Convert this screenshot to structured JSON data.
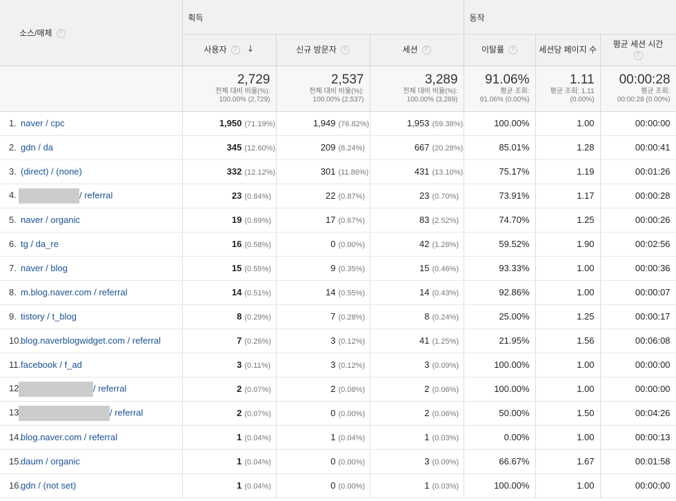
{
  "headers": {
    "source": "소스/매체",
    "group_acq": "획득",
    "group_beh": "동작",
    "users": "사용자",
    "new_users": "신규 방문자",
    "sessions": "세션",
    "bounce": "이탈률",
    "pages_per_session": "세션당 페이지 수",
    "avg_duration": "평균 세션 시간",
    "help_icon": "?",
    "sort_icon": "↓"
  },
  "totals": {
    "users": {
      "value": "2,729",
      "sub1": "전체 대비 비율(%):",
      "sub2": "100.00% (2,729)"
    },
    "new_users": {
      "value": "2,537",
      "sub1": "전체 대비 비율(%):",
      "sub2": "100.00% (2,537)"
    },
    "sessions": {
      "value": "3,289",
      "sub1": "전체 대비 비율(%):",
      "sub2": "100.00% (3,289)"
    },
    "bounce": {
      "value": "91.06%",
      "sub1": "평균 조회:",
      "sub2": "91.06% (0.00%)"
    },
    "pages": {
      "value": "1.11",
      "sub1": "평균 조회: 1.11",
      "sub2": "(0.00%)"
    },
    "duration": {
      "value": "00:00:28",
      "sub1": "평균 조회:",
      "sub2": "00:00:28 (0.00%)"
    }
  },
  "rows": [
    {
      "idx": "1.",
      "source": "naver / cpc",
      "users": "1,950",
      "users_pct": "(71.19%)",
      "new_users": "1,949",
      "new_users_pct": "(76.82%)",
      "sessions": "1,953",
      "sessions_pct": "(59.38%)",
      "bounce": "100.00%",
      "pages": "1.00",
      "duration": "00:00:00"
    },
    {
      "idx": "2.",
      "source": "gdn / da",
      "users": "345",
      "users_pct": "(12.60%)",
      "new_users": "209",
      "new_users_pct": "(8.24%)",
      "sessions": "667",
      "sessions_pct": "(20.28%)",
      "bounce": "85.01%",
      "pages": "1.28",
      "duration": "00:00:41"
    },
    {
      "idx": "3.",
      "source": "(direct) / (none)",
      "users": "332",
      "users_pct": "(12.12%)",
      "new_users": "301",
      "new_users_pct": "(11.86%)",
      "sessions": "431",
      "sessions_pct": "(13.10%)",
      "bounce": "75.17%",
      "pages": "1.19",
      "duration": "00:01:26"
    },
    {
      "idx": "4.",
      "source": "/ referral",
      "redacted": true,
      "users": "23",
      "users_pct": "(0.84%)",
      "new_users": "22",
      "new_users_pct": "(0.87%)",
      "sessions": "23",
      "sessions_pct": "(0.70%)",
      "bounce": "73.91%",
      "pages": "1.17",
      "duration": "00:00:28"
    },
    {
      "idx": "5.",
      "source": "naver / organic",
      "users": "19",
      "users_pct": "(0.69%)",
      "new_users": "17",
      "new_users_pct": "(0.67%)",
      "sessions": "83",
      "sessions_pct": "(2.52%)",
      "bounce": "74.70%",
      "pages": "1.25",
      "duration": "00:00:26"
    },
    {
      "idx": "6.",
      "source": "tg / da_re",
      "users": "16",
      "users_pct": "(0.58%)",
      "new_users": "0",
      "new_users_pct": "(0.00%)",
      "sessions": "42",
      "sessions_pct": "(1.28%)",
      "bounce": "59.52%",
      "pages": "1.90",
      "duration": "00:02:56"
    },
    {
      "idx": "7.",
      "source": "naver / blog",
      "users": "15",
      "users_pct": "(0.55%)",
      "new_users": "9",
      "new_users_pct": "(0.35%)",
      "sessions": "15",
      "sessions_pct": "(0.46%)",
      "bounce": "93.33%",
      "pages": "1.00",
      "duration": "00:00:36"
    },
    {
      "idx": "8.",
      "source": "m.blog.naver.com / referral",
      "users": "14",
      "users_pct": "(0.51%)",
      "new_users": "14",
      "new_users_pct": "(0.55%)",
      "sessions": "14",
      "sessions_pct": "(0.43%)",
      "bounce": "92.86%",
      "pages": "1.00",
      "duration": "00:00:07"
    },
    {
      "idx": "9.",
      "source": "tistory / t_blog",
      "users": "8",
      "users_pct": "(0.29%)",
      "new_users": "7",
      "new_users_pct": "(0.28%)",
      "sessions": "8",
      "sessions_pct": "(0.24%)",
      "bounce": "25.00%",
      "pages": "1.25",
      "duration": "00:00:17"
    },
    {
      "idx": "10.",
      "source": "blog.naverblogwidget.com / referral",
      "users": "7",
      "users_pct": "(0.26%)",
      "new_users": "3",
      "new_users_pct": "(0.12%)",
      "sessions": "41",
      "sessions_pct": "(1.25%)",
      "bounce": "21.95%",
      "pages": "1.56",
      "duration": "00:06:08"
    },
    {
      "idx": "11.",
      "source": "facebook / f_ad",
      "users": "3",
      "users_pct": "(0.11%)",
      "new_users": "3",
      "new_users_pct": "(0.12%)",
      "sessions": "3",
      "sessions_pct": "(0.09%)",
      "bounce": "100.00%",
      "pages": "1.00",
      "duration": "00:00:00"
    },
    {
      "idx": "12.",
      "source": "/ referral",
      "redacted": true,
      "users": "2",
      "users_pct": "(0.07%)",
      "new_users": "2",
      "new_users_pct": "(0.08%)",
      "sessions": "2",
      "sessions_pct": "(0.06%)",
      "bounce": "100.00%",
      "pages": "1.00",
      "duration": "00:00:00"
    },
    {
      "idx": "13.",
      "source": "/ referral",
      "redacted": true,
      "users": "2",
      "users_pct": "(0.07%)",
      "new_users": "0",
      "new_users_pct": "(0.00%)",
      "sessions": "2",
      "sessions_pct": "(0.06%)",
      "bounce": "50.00%",
      "pages": "1.50",
      "duration": "00:04:26"
    },
    {
      "idx": "14.",
      "source": "blog.naver.com / referral",
      "users": "1",
      "users_pct": "(0.04%)",
      "new_users": "1",
      "new_users_pct": "(0.04%)",
      "sessions": "1",
      "sessions_pct": "(0.03%)",
      "bounce": "0.00%",
      "pages": "1.00",
      "duration": "00:00:13"
    },
    {
      "idx": "15.",
      "source": "daum / organic",
      "users": "1",
      "users_pct": "(0.04%)",
      "new_users": "0",
      "new_users_pct": "(0.00%)",
      "sessions": "3",
      "sessions_pct": "(0.09%)",
      "bounce": "66.67%",
      "pages": "1.67",
      "duration": "00:01:58"
    },
    {
      "idx": "16.",
      "source": "gdn / (not set)",
      "users": "1",
      "users_pct": "(0.04%)",
      "new_users": "0",
      "new_users_pct": "(0.00%)",
      "sessions": "1",
      "sessions_pct": "(0.03%)",
      "bounce": "100.00%",
      "pages": "1.00",
      "duration": "00:00:00"
    }
  ]
}
